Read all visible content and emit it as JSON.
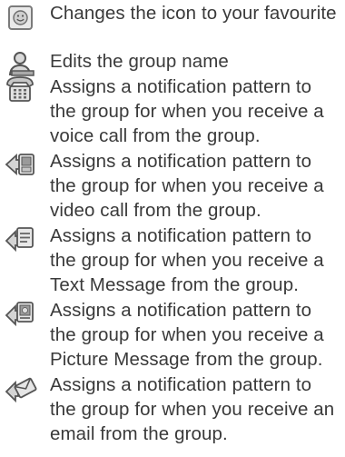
{
  "items": [
    {
      "icon": "smiley-icon",
      "text": "Changes the icon to your favourite"
    },
    {
      "icon": "person-icon",
      "text": "Edits the group name"
    },
    {
      "icon": "telephone-icon",
      "text": "Assigns a notification pattern to the group for when you receive a voice call from the group."
    },
    {
      "icon": "video-call-icon",
      "text": "Assigns a notification pattern to the group for when you receive a video call from the group."
    },
    {
      "icon": "text-message-icon",
      "text": "Assigns a notification pattern to the group for when you receive a Text Message from the group."
    },
    {
      "icon": "picture-message-icon",
      "text": "Assigns a notification pattern to the group for when you receive a Picture Message from the group."
    },
    {
      "icon": "email-icon",
      "text": "Assigns a notification pattern to the group for when you receive an email from the group."
    }
  ]
}
